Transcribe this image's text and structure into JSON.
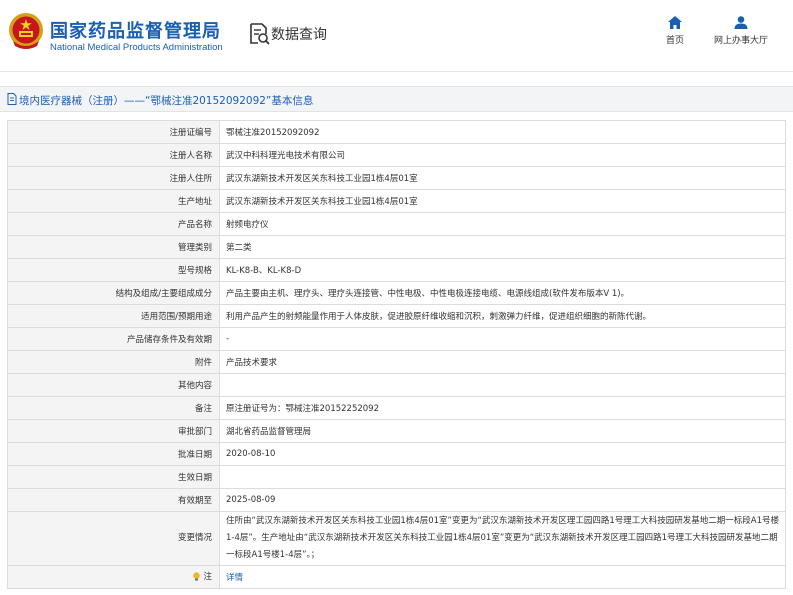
{
  "header": {
    "site_name_cn": "国家药品监督管理局",
    "site_name_en": "National Medical Products Administration",
    "section_title": "数据查询",
    "nav": [
      {
        "label": "首页",
        "icon": "home-icon"
      },
      {
        "label": "网上办事大厅",
        "icon": "user-icon"
      }
    ]
  },
  "title_bar": {
    "text": "境内医疗器械（注册）——“鄂械注准20152092092”基本信息"
  },
  "colors": {
    "brand_blue": "#1a5fb4",
    "label_bg": "#f4f4f4",
    "border": "#dcdcdc"
  },
  "rows": [
    {
      "label": "注册证编号",
      "value": "鄂械注准20152092092"
    },
    {
      "label": "注册人名称",
      "value": "武汉中科科理光电技术有限公司"
    },
    {
      "label": "注册人住所",
      "value": "武汉东湖新技术开发区关东科技工业园1栋4层01室"
    },
    {
      "label": "生产地址",
      "value": "武汉东湖新技术开发区关东科技工业园1栋4层01室"
    },
    {
      "label": "产品名称",
      "value": "射频电疗仪"
    },
    {
      "label": "管理类别",
      "value": "第二类"
    },
    {
      "label": "型号规格",
      "value": "KL-K8-B、KL-K8-D"
    },
    {
      "label": "结构及组成/主要组成成分",
      "value": "产品主要由主机、理疗头、理疗头连接管、中性电极、中性电极连接电缆、电源线组成(软件发布版本V 1)。"
    },
    {
      "label": "适用范围/预期用途",
      "value": "利用产品产生的射频能量作用于人体皮肤，促进胶原纤维收缩和沉积，刺激弹力纤维，促进组织细胞的新陈代谢。"
    },
    {
      "label": "产品储存条件及有效期",
      "value": "-"
    },
    {
      "label": "附件",
      "value": "产品技术要求"
    },
    {
      "label": "其他内容",
      "value": ""
    },
    {
      "label": "备注",
      "value": "原注册证号为：鄂械注准20152252092"
    },
    {
      "label": "审批部门",
      "value": "湖北省药品监督管理局"
    },
    {
      "label": "批准日期",
      "value": "2020-08-10"
    },
    {
      "label": "生效日期",
      "value": ""
    },
    {
      "label": "有效期至",
      "value": "2025-08-09"
    },
    {
      "label": "变更情况",
      "value": "住所由“武汉东湖新技术开发区关东科技工业园1栋4层01室”变更为“武汉东湖新技术开发区理工园四路1号理工大科技园研发基地二期一标段A1号楼1-4层”。生产地址由“武汉东湖新技术开发区关东科技工业园1栋4层01室”变更为“武汉东湖新技术开发区理工园四路1号理工大科技园研发基地二期一标段A1号楼1-4层”。；"
    }
  ],
  "note": {
    "label": "注",
    "icon": "bulb-icon",
    "link_text": "详情"
  }
}
